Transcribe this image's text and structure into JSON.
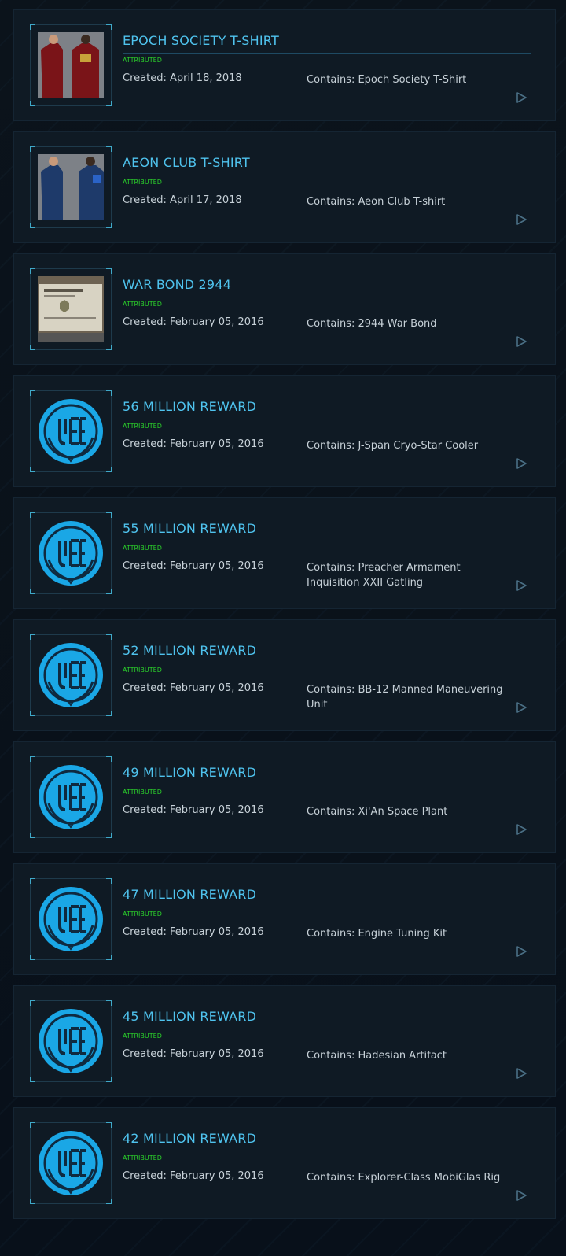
{
  "items": [
    {
      "title": "EPOCH SOCIETY T-SHIRT",
      "badge": "ATTRIBUTED",
      "created": "Created: April 18, 2018",
      "contains": "Contains: Epoch Society T-Shirt",
      "thumb": "red-tshirt-photo"
    },
    {
      "title": "AEON CLUB T-SHIRT",
      "badge": "ATTRIBUTED",
      "created": "Created: April 17, 2018",
      "contains": "Contains: Aeon Club T-shirt",
      "thumb": "blue-tshirt-photo"
    },
    {
      "title": "WAR BOND 2944",
      "badge": "ATTRIBUTED",
      "created": "Created: February 05, 2016",
      "contains": "Contains: 2944 War Bond",
      "thumb": "war-bond-photo"
    },
    {
      "title": "56 MILLION REWARD",
      "badge": "ATTRIBUTED",
      "created": "Created: February 05, 2016",
      "contains": "Contains: J-Span Cryo-Star Cooler",
      "thumb": "uee-logo"
    },
    {
      "title": "55 MILLION REWARD",
      "badge": "ATTRIBUTED",
      "created": "Created: February 05, 2016",
      "contains": "Contains: Preacher Armament Inquisition XXII Gatling",
      "thumb": "uee-logo"
    },
    {
      "title": "52 MILLION REWARD",
      "badge": "ATTRIBUTED",
      "created": "Created: February 05, 2016",
      "contains": "Contains: BB-12 Manned Maneuvering Unit",
      "thumb": "uee-logo"
    },
    {
      "title": "49 MILLION REWARD",
      "badge": "ATTRIBUTED",
      "created": "Created: February 05, 2016",
      "contains": "Contains: Xi'An Space Plant",
      "thumb": "uee-logo"
    },
    {
      "title": "47 MILLION REWARD",
      "badge": "ATTRIBUTED",
      "created": "Created: February 05, 2016",
      "contains": "Contains: Engine Tuning Kit",
      "thumb": "uee-logo"
    },
    {
      "title": "45 MILLION REWARD",
      "badge": "ATTRIBUTED",
      "created": "Created: February 05, 2016",
      "contains": "Contains: Hadesian Artifact",
      "thumb": "uee-logo"
    },
    {
      "title": "42 MILLION REWARD",
      "badge": "ATTRIBUTED",
      "created": "Created: February 05, 2016",
      "contains": "Contains: Explorer-Class MobiGlas Rig",
      "thumb": "uee-logo"
    }
  ],
  "colors": {
    "title": "#4fc3ee",
    "badge": "#2bd12b",
    "text": "#c7d1d8",
    "logo": "#1aa7e6"
  }
}
